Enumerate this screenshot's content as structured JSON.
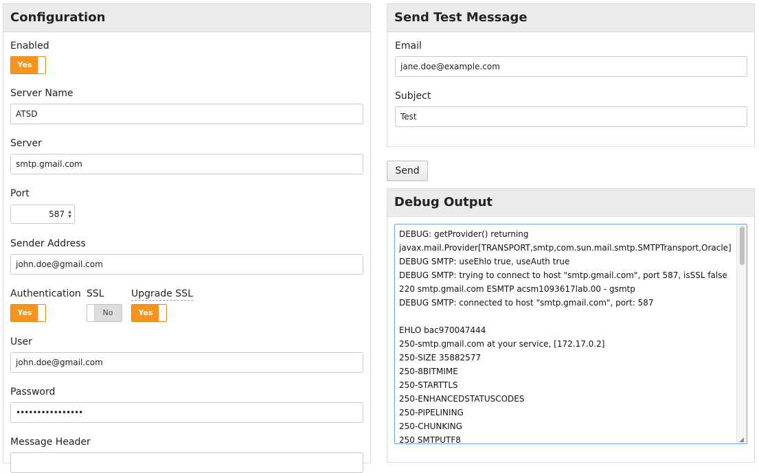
{
  "config": {
    "title": "Configuration",
    "enabled_label": "Enabled",
    "enabled_value": "Yes",
    "server_name_label": "Server Name",
    "server_name_value": "ATSD",
    "server_label": "Server",
    "server_value": "smtp.gmail.com",
    "port_label": "Port",
    "port_value": "587",
    "sender_label": "Sender Address",
    "sender_value": "john.doe@gmail.com",
    "auth_label": "Authentication",
    "auth_value": "Yes",
    "ssl_label": "SSL",
    "ssl_value": "No",
    "upgrade_ssl_label": "Upgrade SSL",
    "upgrade_ssl_value": "Yes",
    "user_label": "User",
    "user_value": "john.doe@gmail.com",
    "password_label": "Password",
    "password_value": "••••••••••••••••",
    "message_header_label": "Message Header"
  },
  "test": {
    "title": "Send Test Message",
    "email_label": "Email",
    "email_value": "jane.doe@example.com",
    "subject_label": "Subject",
    "subject_value": "Test",
    "send_label": "Send"
  },
  "debug": {
    "title": "Debug Output",
    "lines": [
      "DEBUG: getProvider() returning",
      "javax.mail.Provider[TRANSPORT,smtp,com.sun.mail.smtp.SMTPTransport,Oracle]",
      "DEBUG SMTP: useEhlo true, useAuth true",
      "DEBUG SMTP: trying to connect to host \"smtp.gmail.com\", port 587, isSSL false",
      "220 smtp.gmail.com ESMTP acsm1093617lab.00 - gsmtp",
      "DEBUG SMTP: connected to host \"smtp.gmail.com\", port: 587",
      "",
      "EHLO bac970047444",
      "250-smtp.gmail.com at your service, [172.17.0.2]",
      "250-SIZE 35882577",
      "250-8BITMIME",
      "250-STARTTLS",
      "250-ENHANCEDSTATUSCODES",
      "250-PIPELINING",
      "250-CHUNKING",
      "250 SMTPUTF8"
    ]
  },
  "colors": {
    "toggle_on": "#f7941d",
    "toggle_off": "#dddddd",
    "focus_border": "#6aa0e8",
    "panel_header": "#ebebeb"
  }
}
